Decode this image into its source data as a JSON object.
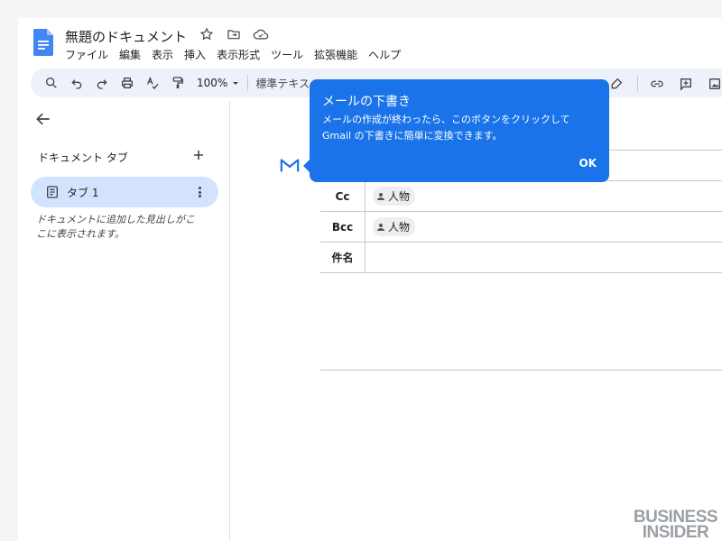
{
  "document": {
    "title": "無題のドキュメント"
  },
  "menu": [
    "ファイル",
    "編集",
    "表示",
    "挿入",
    "表示形式",
    "ツール",
    "拡張機能",
    "ヘルプ"
  ],
  "toolbar": {
    "zoom": "100%",
    "style_value": "標準テキスト"
  },
  "sidebar": {
    "tabs_header": "ドキュメント タブ",
    "tab_label": "タブ 1",
    "outline_hint": "ドキュメントに追加した見出しがここに表示されます。"
  },
  "email_draft": {
    "rows": [
      {
        "label": "Cc",
        "chip": "人物"
      },
      {
        "label": "Bcc",
        "chip": "人物"
      },
      {
        "label": "件名",
        "chip": ""
      }
    ]
  },
  "tooltip": {
    "title": "メールの下書き",
    "body": "メールの作成が終わったら、このボタンをクリックして Gmail の下書きに簡単に変換できます。",
    "ok": "OK"
  },
  "watermark": {
    "line1": "BUSINESS",
    "line2": "INSIDER"
  },
  "colors": {
    "accent": "#1a73e8",
    "toolbar_bg": "#edf2fa",
    "tab_selected": "#d3e3fd"
  }
}
